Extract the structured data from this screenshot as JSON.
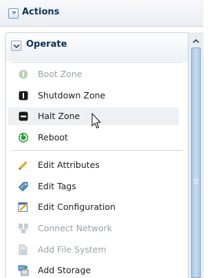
{
  "actions": {
    "title": "Actions",
    "expand_icon": "double-chevron-right-icon"
  },
  "panel": {
    "title": "Operate",
    "collapse_icon": "chevron-down-icon",
    "items": [
      {
        "label": "Boot Zone",
        "icon": "boot-zone-icon",
        "disabled": true
      },
      {
        "label": "Shutdown Zone",
        "icon": "shutdown-zone-icon",
        "disabled": false
      },
      {
        "label": "Halt Zone",
        "icon": "halt-zone-icon",
        "disabled": false,
        "hovered": true
      },
      {
        "label": "Reboot",
        "icon": "reboot-icon",
        "disabled": false
      },
      {
        "label": "Edit Attributes",
        "icon": "pencil-icon",
        "disabled": false
      },
      {
        "label": "Edit Tags",
        "icon": "tag-icon",
        "disabled": false
      },
      {
        "label": "Edit Configuration",
        "icon": "edit-config-icon",
        "disabled": false
      },
      {
        "label": "Connect Network",
        "icon": "connect-network-icon",
        "disabled": true
      },
      {
        "label": "Add File System",
        "icon": "add-file-system-icon",
        "disabled": true
      },
      {
        "label": "Add Storage",
        "icon": "add-storage-icon",
        "disabled": false
      }
    ]
  },
  "colors": {
    "header_text": "#10355e",
    "disabled_text": "#9aa0a6",
    "hover_bg": "#eef1f4",
    "scroll_thumb": "#b7d0ea"
  }
}
